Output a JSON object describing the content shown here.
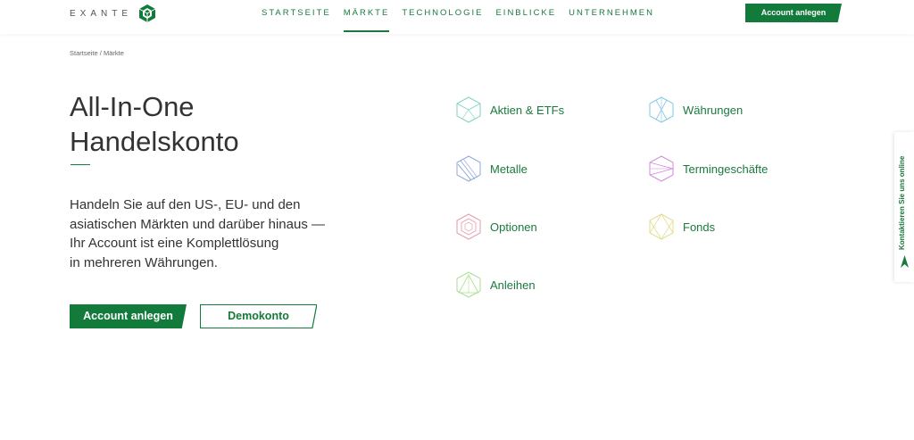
{
  "header": {
    "logo_text": "EXANTE",
    "nav": [
      {
        "label": "STARTSEITE"
      },
      {
        "label": "MÄRKTE"
      },
      {
        "label": "TECHNOLOGIE"
      },
      {
        "label": "EINBLICKE"
      },
      {
        "label": "UNTERNEHMEN"
      }
    ],
    "active_nav": "MÄRKTE",
    "cta_label": "Account anlegen"
  },
  "breadcrumb": {
    "home": "Startseite",
    "separator": "/",
    "current": "Märkte"
  },
  "hero": {
    "title_line1": "All-In-One",
    "title_line2": "Handelskonto",
    "desc_line1": "Handeln Sie auf den US-, EU- und den",
    "desc_line2": "asiatischen Märkten und darüber hinaus —",
    "desc_line3": "Ihr Account ist eine Komplettlösung",
    "desc_line4": "in mehreren Währungen.",
    "primary_button": "Account anlegen",
    "secondary_button": "Demokonto"
  },
  "markets": [
    {
      "label": "Aktien & ETFs",
      "icon": "stocks-icon",
      "color": "#7fd3c0"
    },
    {
      "label": "Währungen",
      "icon": "currencies-icon",
      "color": "#7ec8e3"
    },
    {
      "label": "Metalle",
      "icon": "metals-icon",
      "color": "#8fa8d8"
    },
    {
      "label": "Termingeschäfte",
      "icon": "futures-icon",
      "color": "#d08ad8"
    },
    {
      "label": "Optionen",
      "icon": "options-icon",
      "color": "#e39aa8"
    },
    {
      "label": "Fonds",
      "icon": "funds-icon",
      "color": "#dfe08a"
    },
    {
      "label": "Anleihen",
      "icon": "bonds-icon",
      "color": "#a8e08e"
    }
  ],
  "side_tab": {
    "label": "Kontaktieren Sie uns online",
    "icon": "send-arrow-icon"
  },
  "colors": {
    "brand_green": "#127a3a",
    "text": "#333333"
  }
}
